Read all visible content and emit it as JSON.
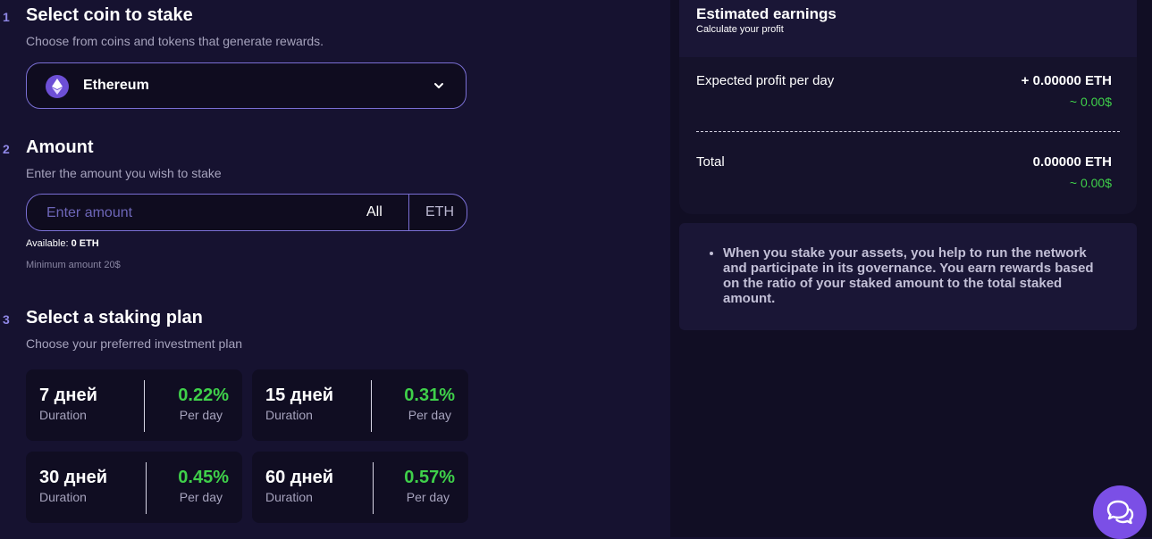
{
  "steps": [
    {
      "number": "1",
      "title": "Select coin to stake",
      "subtitle": "Choose from coins and tokens that generate rewards."
    },
    {
      "number": "2",
      "title": "Amount",
      "subtitle": "Enter the amount you wish to stake"
    },
    {
      "number": "3",
      "title": "Select a staking plan",
      "subtitle": "Choose your preferred investment plan"
    }
  ],
  "coin_select": {
    "selected": "Ethereum",
    "icon": "ethereum-icon"
  },
  "amount": {
    "placeholder": "Enter amount",
    "all_label": "All",
    "unit": "ETH",
    "available_label": "Available:",
    "available_value": "0 ETH",
    "minimum": "Minimum amount 20$"
  },
  "plans": [
    {
      "days": "7 дней",
      "duration_label": "Duration",
      "rate": "0.22%",
      "per_day_label": "Per day"
    },
    {
      "days": "15 дней",
      "duration_label": "Duration",
      "rate": "0.31%",
      "per_day_label": "Per day"
    },
    {
      "days": "30 дней",
      "duration_label": "Duration",
      "rate": "0.45%",
      "per_day_label": "Per day"
    },
    {
      "days": "60 дней",
      "duration_label": "Duration",
      "rate": "0.57%",
      "per_day_label": "Per day"
    }
  ],
  "earnings": {
    "title": "Estimated earnings",
    "subtitle": "Calculate your profit",
    "daily_label": "Expected profit per day",
    "daily_value": "+ 0.00000 ETH",
    "daily_usd": "~ 0.00$",
    "total_label": "Total",
    "total_value": "0.00000 ETH",
    "total_usd": "~ 0.00$"
  },
  "info": {
    "text": "When you stake your assets, you help to run the network and participate in its governance. You earn rewards based on the ratio of your staked amount to the total staked amount."
  },
  "chat": {
    "icon": "chat-icon"
  },
  "colors": {
    "accent": "#7a6fd4",
    "positive": "#3fd04a",
    "chat": "#7b4fe6"
  }
}
